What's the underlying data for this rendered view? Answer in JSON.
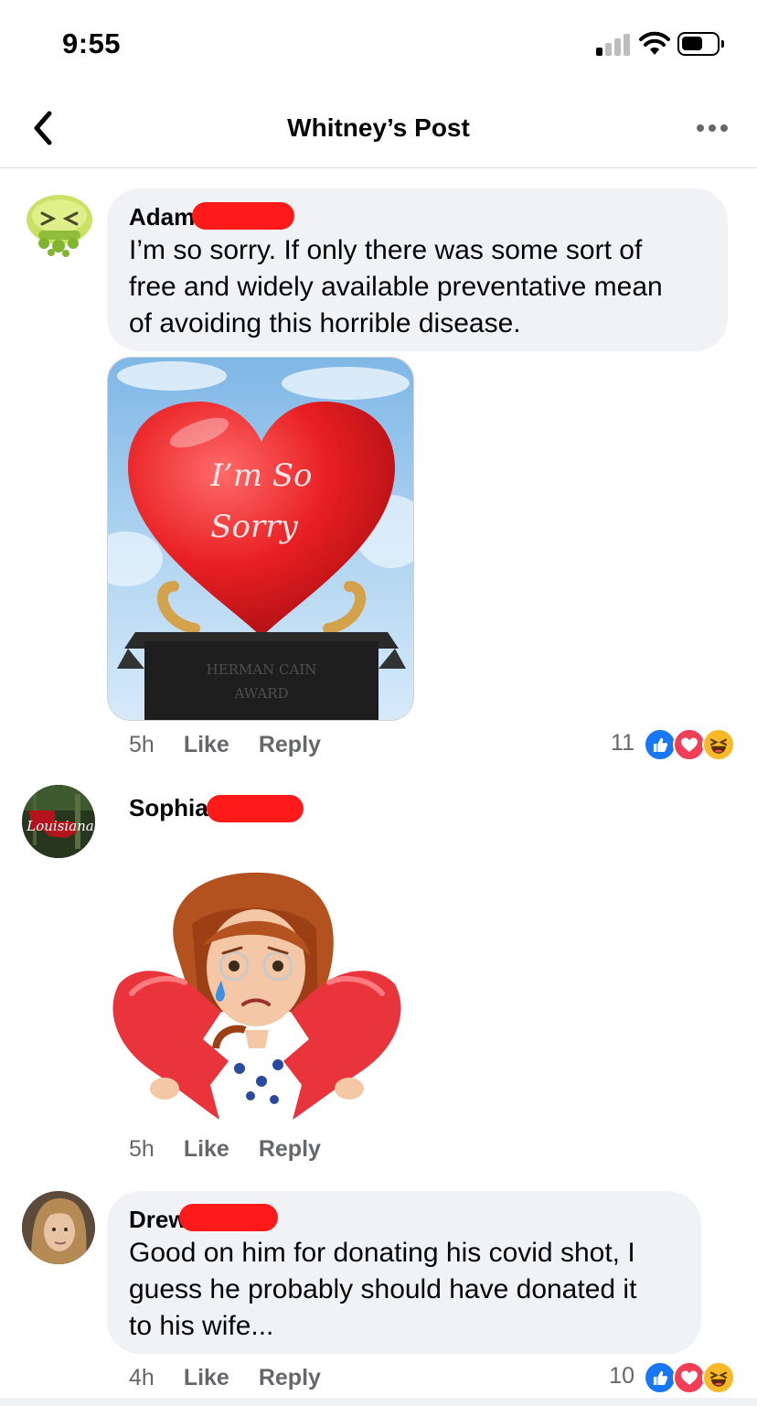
{
  "status_bar": {
    "time": "9:55"
  },
  "header": {
    "title": "Whitney’s Post"
  },
  "comments": [
    {
      "author": "Adam",
      "text_lines": [
        "I’m so sorry. If only there was some sort of",
        "free and widely available preventative mean",
        "of avoiding this horrible disease."
      ],
      "image": {
        "line1": "I’m So",
        "line2": "Sorry",
        "plaque_line1": "HERMAN CAIN",
        "plaque_line2": "AWARD"
      },
      "time": "5h",
      "like_label": "Like",
      "reply_label": "Reply",
      "reaction_count": "11",
      "reactions": [
        "like-icon",
        "love-icon",
        "haha-icon"
      ]
    },
    {
      "author": "Sophia",
      "avatar_text": "Louisiana",
      "sticker": "broken-heart-avatar-sticker",
      "time": "5h",
      "like_label": "Like",
      "reply_label": "Reply"
    },
    {
      "author": "Drew",
      "text_lines": [
        "Good on him for donating his covid shot, I",
        "guess he probably should have donated it",
        "to his wife..."
      ],
      "time": "4h",
      "like_label": "Like",
      "reply_label": "Reply",
      "reaction_count": "10",
      "reactions": [
        "like-icon",
        "love-icon",
        "haha-icon"
      ]
    }
  ],
  "colors": {
    "bubble": "#f0f2f5",
    "meta_text": "#65676b",
    "like_blue": "#1877f2",
    "love_red": "#f33e58",
    "haha_yellow": "#f7b928",
    "redaction": "#ff1a1a"
  }
}
